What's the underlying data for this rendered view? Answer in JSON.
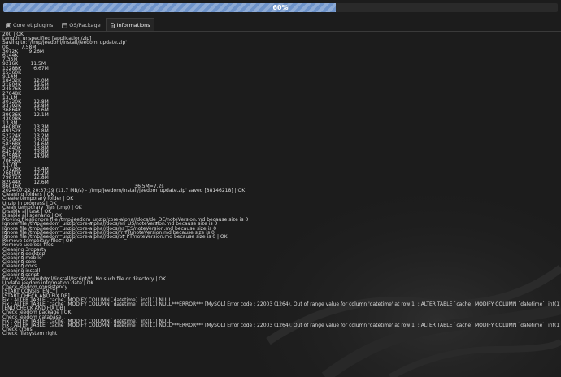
{
  "progress": {
    "label": "60%",
    "value_percent": 60
  },
  "tabs": [
    {
      "label": "Core et plugins",
      "icon": "plug-icon",
      "active": false
    },
    {
      "label": "OS/Package",
      "icon": "package-icon",
      "active": false
    },
    {
      "label": "Informations",
      "icon": "document-icon",
      "active": true
    }
  ],
  "colors": {
    "background": "#1c1c1c",
    "progress_fill": "#6e93c9",
    "text": "#dcdcdc"
  },
  "log_lines": [
    "200 | OK",
    "Length: unspecified [application/zip]",
    "Saving to: '/tmp/jeedom/install/jeedom_update.zip'",
    "0K        7.58M",
    "3072K       9.26M",
    "6144K",
    "7.35M",
    "9216K        11.5M",
    "12288K        6.67M",
    "15360K",
    "9.14M",
    "18432K        12.0M",
    "21504K        13.5M",
    "24576K        13.0M",
    "27648K",
    "13.1M",
    "30720K        12.8M",
    "33792K        13.8M",
    "36864K        13.6M",
    "39936K        12.1M",
    "43008K",
    "13.8M",
    "46080K        13.3M",
    "49152K        13.8M",
    "52224K        13.2M",
    "55296K        13.0M",
    "58368K        14.6M",
    "61440K        13.8M",
    "64512K        13.8M",
    "67584K        14.9M",
    "70656K",
    "13.7M",
    "73728K        13.4M",
    "76800K        12.2M",
    "79872K        12.8M",
    "82944K        12.6M",
    "86016K                                                                         36.5M=7.2s",
    "2024-07-22 20:37:19 (11.7 MB/s) - '/tmp/jeedom/install/jeedom_update.zip' saved [88146218] | OK",
    "Cleaning folders | OK",
    "Create temporary folder | OK",
    "Unzip in progress | OK",
    "Clean temporary files (tmp) | OK",
    "Disable all task | OK",
    "Disable all scenario | OK",
    "Moving files|ignore file /tmp/jeedom_unzip/core-alpha//docs/de_DE/noteVersion.md because size is 0",
    "Ignore file /tmp/jeedom_unzip/core-alpha//docs/en_US/noteVersion.md because size is 0",
    "Ignore file /tmp/jeedom_unzip/core-alpha//docs/es_ES/noteVersion.md because size is 0",
    "Ignore file /tmp/jeedom_unzip/core-alpha//docs/fr_FR/noteVersion.md because size is 0",
    "Ignore file /tmp/jeedom_unzip/core-alpha//docs/pt_PT/noteVersion.md because size is 0 | OK",
    "Remove temporary files | OK",
    "Remove useless files",
    "Cleaning 3rdparty",
    "Cleaning desktop",
    "Cleaning mobile",
    "Cleaning core",
    "Cleaning docs",
    "Cleaning install",
    "Cleaning script",
    "find: '/var/www/html//install//script/*': No such file or directory | OK",
    "Update jeedom information date | OK",
    "Check jeedom consistency",
    "[START CONSISTENCY]",
    "[START CHECK AND FIX DB]",
    "Fix : ALTER TABLE `cache` MODIFY COLUMN `datetime`  int(11) NULL",
    "Fix : ALTER TABLE `cache` MODIFY COLUMN `datetime`  int(11) NULL***ERROR*** [MySQL] Error code : 22003 (1264). Out of range value for column 'datetime' at row 1  : ALTER TABLE `cache` MODIFY COLUMN `datetime`  int(11) NULL",
    "[END CHECK AND FIX DB]",
    "Check jeedom package | OK",
    "Check jeedom database",
    "Fix : ALTER TABLE `cache` MODIFY COLUMN `datetime`  int(11) NULL",
    "Fix : ALTER TABLE `cache` MODIFY COLUMN `datetime`  int(11) NULL***ERROR*** [MySQL] Error code : 22003 (1264). Out of range value for column 'datetime' at row 1  : ALTER TABLE `cache` MODIFY COLUMN `datetime`  int(11) NULL",
    "Check crons",
    "Check filesystem right"
  ]
}
